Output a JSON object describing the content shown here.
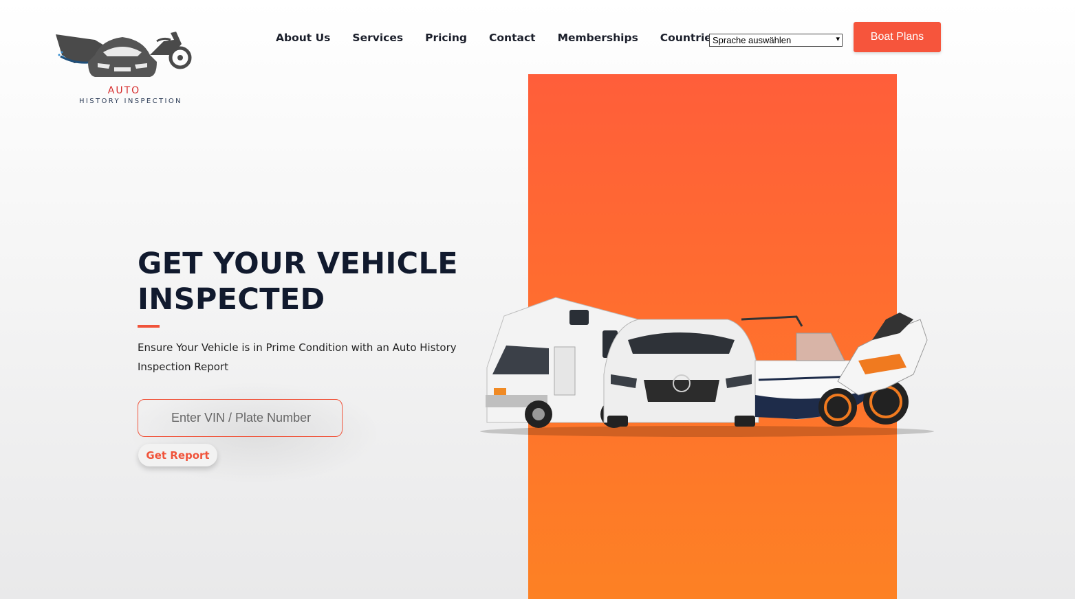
{
  "brand": {
    "line1": "AUTO",
    "line2": "HISTORY INSPECTION",
    "logo_icon": "car-boat-motorcycle-logo"
  },
  "nav": {
    "items": [
      "About Us",
      "Services",
      "Pricing",
      "Contact",
      "Memberships",
      "Countries"
    ]
  },
  "language_select": {
    "value": "Sprache auswählen"
  },
  "header_button": {
    "label": "Boat Plans"
  },
  "hero": {
    "title_line1": "GET YOUR VEHICLE",
    "title_line2": "INSPECTED",
    "subtitle": "Ensure Your Vehicle is in Prime Condition with an Auto History Inspection Report",
    "input_placeholder": "Enter VIN / Plate Number",
    "cta_label": "Get Report"
  },
  "colors": {
    "accent": "#f6553c",
    "panel_top": "#ff5e3a",
    "panel_bottom": "#fd8124",
    "heading": "#111a2e"
  }
}
